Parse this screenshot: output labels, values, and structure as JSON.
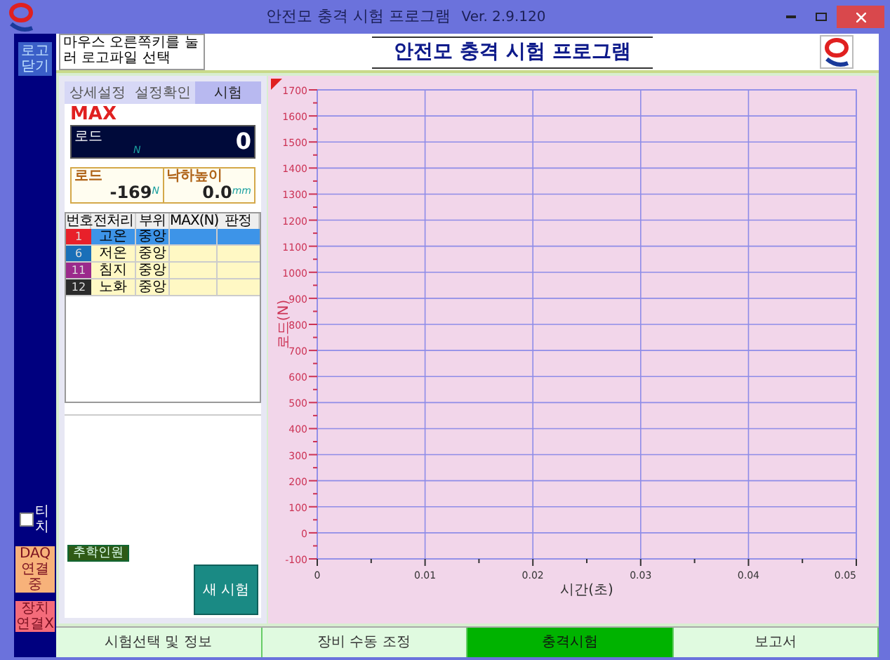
{
  "window": {
    "title": "안전모 충격 시험 프로그램",
    "version": "Ver. 2.9.120"
  },
  "sidebar": {
    "logo_close_button": "로고 닫기",
    "teach": {
      "label": "티치",
      "checked": false
    },
    "status": [
      {
        "label": "DAQ 연결중",
        "color": "#f7b27a"
      },
      {
        "label": "장치 연결X",
        "color": "#f46b7a"
      }
    ]
  },
  "header": {
    "logo_hint": "마우스 오른쪽키를 눌러 로고파일 선택",
    "program_title": "안전모 충격 시험 프로그램"
  },
  "panel_tabs": [
    {
      "label": "상세설정",
      "selected": false
    },
    {
      "label": "설정확인",
      "selected": false
    },
    {
      "label": "시험",
      "selected": true
    }
  ],
  "max_display": {
    "title": "MAX",
    "label": "로드",
    "unit": "N",
    "value": "0"
  },
  "readings": [
    {
      "label": "로드",
      "unit": "N",
      "value": "-169"
    },
    {
      "label": "낙하높이",
      "unit": "mm",
      "value": "0.0"
    }
  ],
  "table": {
    "columns": [
      "번호",
      "전처리",
      "부위",
      "MAX(N)",
      "판정"
    ],
    "rows": [
      {
        "number": "1",
        "color": "#e8202a",
        "pretreatment": "고온",
        "part": "중앙",
        "selected": true
      },
      {
        "number": "6",
        "color": "#1a6fb8",
        "pretreatment": "저온",
        "part": "중앙",
        "selected": false
      },
      {
        "number": "11",
        "color": "#9b2a8c",
        "pretreatment": "침지",
        "part": "중앙",
        "selected": false
      },
      {
        "number": "12",
        "color": "#2b2b2b",
        "pretreatment": "노화",
        "part": "중앙",
        "selected": false
      }
    ]
  },
  "add_people_button": "추학인원",
  "new_test_button": "새 시험",
  "chart": {
    "chart_data": {
      "type": "line",
      "grid": true,
      "xlabel": "시간(초)",
      "ylabel": "로드(N)",
      "xlim": [
        0,
        0.05
      ],
      "ylim": [
        -100,
        1700
      ],
      "xticks": [
        0,
        0.01,
        0.02,
        0.03,
        0.04,
        0.05
      ],
      "yticks": [
        -100,
        0,
        100,
        200,
        300,
        400,
        500,
        600,
        700,
        800,
        900,
        1000,
        1100,
        1200,
        1300,
        1400,
        1500,
        1600,
        1700
      ]
    }
  },
  "bottom_tabs": [
    {
      "label": "시험선택 및 정보",
      "selected": false
    },
    {
      "label": "장비 수동 조정",
      "selected": false
    },
    {
      "label": "충격시험",
      "selected": true
    },
    {
      "label": "보고서",
      "selected": false
    }
  ]
}
